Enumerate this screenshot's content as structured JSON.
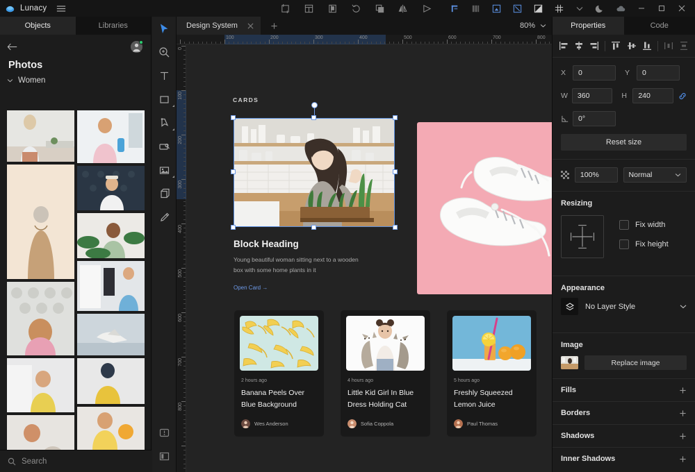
{
  "titlebar": {
    "app_name": "Lunacy",
    "menu_icon": "hamburger-icon",
    "center_tools": [
      {
        "name": "crop-icon"
      },
      {
        "name": "artboard-icon"
      },
      {
        "name": "mask-icon"
      },
      {
        "name": "rotate-copy-icon"
      },
      {
        "name": "union-icon"
      },
      {
        "name": "flip-horizontal-icon"
      },
      {
        "name": "play-preview-icon"
      }
    ],
    "right_tools": [
      {
        "name": "align-guides-icon",
        "active": true
      },
      {
        "name": "layout-grid-icon",
        "active": false
      },
      {
        "name": "pixel-preview-icon",
        "active": true
      },
      {
        "name": "vector-snap-icon",
        "active": true
      },
      {
        "name": "gradient-icon",
        "active": true
      },
      {
        "name": "grid-icon",
        "active": true
      },
      {
        "name": "chevron-down-icon",
        "active": false
      },
      {
        "name": "dark-mode-icon",
        "active": false
      },
      {
        "name": "cloud-icon",
        "active": false
      }
    ],
    "window_controls": [
      {
        "name": "minimize-button"
      },
      {
        "name": "maximize-button"
      },
      {
        "name": "close-button"
      }
    ]
  },
  "left_panel": {
    "tabs": [
      {
        "label": "Objects",
        "active": true
      },
      {
        "label": "Libraries",
        "active": false
      }
    ],
    "back_icon": "back-arrow-icon",
    "avatar": "user-avatar",
    "title": "Photos",
    "group_label": "Women",
    "search_placeholder": "Search"
  },
  "toolbar": {
    "tools": [
      {
        "name": "cursor-tool",
        "active": true,
        "submenu": false
      },
      {
        "name": "zoom-tool",
        "active": false,
        "submenu": false
      },
      {
        "name": "text-tool",
        "active": false,
        "submenu": false
      },
      {
        "name": "rectangle-tool",
        "active": false,
        "submenu": true
      },
      {
        "name": "pen-tool",
        "active": false,
        "submenu": true
      },
      {
        "name": "slice-tool",
        "active": false,
        "submenu": false
      },
      {
        "name": "image-tool",
        "active": false,
        "submenu": true
      },
      {
        "name": "artboard-tool",
        "active": false,
        "submenu": false
      },
      {
        "name": "pencil-tool",
        "active": false,
        "submenu": false
      }
    ],
    "bottom_tools": [
      {
        "name": "comment-tool"
      },
      {
        "name": "toggle-panels-tool"
      }
    ]
  },
  "canvas": {
    "tab_title": "Design System",
    "tab_close_icon": "close-icon",
    "new_tab_icon": "plus-icon",
    "zoom_level": "80%",
    "zoom_chevron": "chevron-down-icon",
    "ruler_h_labels": [
      "100",
      "200",
      "300",
      "400",
      "500",
      "600",
      "700",
      "800"
    ],
    "ruler_v_labels": [
      "0",
      "100",
      "200",
      "300",
      "400",
      "500",
      "600",
      "700",
      "800"
    ],
    "section_label": "CARDS",
    "big_card": {
      "image_name": "woman-with-plants-photo",
      "heading": "Block Heading",
      "body": "Young beautiful woman sitting next to a wooden box with some home plants in it",
      "link": "Open Card →"
    },
    "shoe_card": {
      "image_name": "white-sneakers-pink-background-photo"
    },
    "small_cards": [
      {
        "image_name": "banana-peel-pattern-photo",
        "ago": "2 hours ago",
        "title": "Banana Peels Over Blue Background",
        "author": "Wes Anderson"
      },
      {
        "image_name": "girl-holding-cat-photo",
        "ago": "4 hours ago",
        "title": "Little Kid Girl In Blue Dress Holding Cat",
        "author": "Sofia Coppola"
      },
      {
        "image_name": "lemon-juice-photo",
        "ago": "5 hours ago",
        "title": "Freshly Squeezed Lemon Juice",
        "author": "Paul Thomas"
      }
    ]
  },
  "right_panel": {
    "tabs": [
      {
        "label": "Properties",
        "active": true
      },
      {
        "label": "Code",
        "active": false
      }
    ],
    "align_buttons": [
      {
        "name": "align-left-icon",
        "enabled": true
      },
      {
        "name": "align-center-horizontal-icon",
        "enabled": true
      },
      {
        "name": "align-right-icon",
        "enabled": true
      },
      {
        "name": "align-top-icon",
        "enabled": true
      },
      {
        "name": "align-middle-vertical-icon",
        "enabled": true
      },
      {
        "name": "align-bottom-icon",
        "enabled": true
      },
      {
        "name": "distribute-horizontal-icon",
        "enabled": false
      },
      {
        "name": "distribute-vertical-icon",
        "enabled": false
      }
    ],
    "x_label": "X",
    "x_value": "0",
    "y_label": "Y",
    "y_value": "0",
    "w_label": "W",
    "w_value": "360",
    "h_label": "H",
    "h_value": "240",
    "link_icon": "link-ratio-icon",
    "rotation_label": "rotation-icon",
    "rotation_value": "0°",
    "reset_size_label": "Reset size",
    "opacity_icon": "opacity-icon",
    "opacity_value": "100%",
    "blend_mode": "Normal",
    "resizing_title": "Resizing",
    "resize_pad_icon": "resize-constraints-icon",
    "fix_width_label": "Fix width",
    "fix_height_label": "Fix height",
    "appearance_title": "Appearance",
    "layer_style_icon": "layer-style-icon",
    "layer_style_value": "No Layer Style",
    "image_title": "Image",
    "image_thumb_name": "selected-image-thumbnail",
    "replace_image_label": "Replace image",
    "sections": [
      {
        "label": "Fills",
        "add_icon": "plus-icon"
      },
      {
        "label": "Borders",
        "add_icon": "plus-icon"
      },
      {
        "label": "Shadows",
        "add_icon": "plus-icon"
      },
      {
        "label": "Inner Shadows",
        "add_icon": "plus-icon"
      }
    ]
  },
  "colors": {
    "accent": "#346ebe",
    "link": "#6e9ae8",
    "selection": "#6f9ce8",
    "status_online": "#2dcc70",
    "shoe_card_bg": "#f4aab4",
    "banana_bg": "#cfe8e4",
    "lemon_bg": "#73b7d9"
  }
}
